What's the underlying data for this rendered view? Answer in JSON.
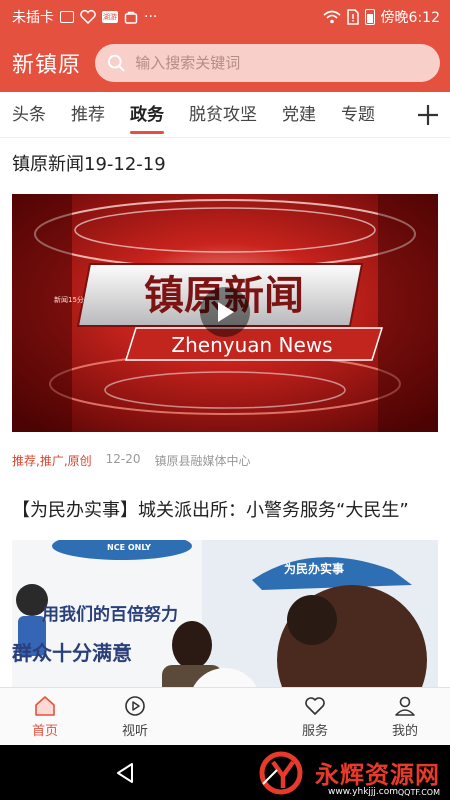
{
  "status_bar": {
    "carrier": "未插卡",
    "time": "傍晚6:12",
    "badge_text": "湖游"
  },
  "header": {
    "app_name": "新镇原",
    "search_placeholder": "输入搜索关键词"
  },
  "tabs": [
    {
      "label": "头条",
      "active": false
    },
    {
      "label": "推荐",
      "active": false
    },
    {
      "label": "政务",
      "active": true
    },
    {
      "label": "脱贫攻坚",
      "active": false
    },
    {
      "label": "党建",
      "active": false
    },
    {
      "label": "专题",
      "active": false
    }
  ],
  "feed": [
    {
      "title": "镇原新闻19-12-19",
      "thumbnail_title": "镇原新闻",
      "thumbnail_subtitle": "Zhenyuan News",
      "thumbnail_small": "新闻15分",
      "has_play_button": true,
      "tags": "推荐,推广,原创",
      "date": "12-20",
      "source": "镇原县融媒体中心"
    },
    {
      "title": "【为民办实事】城关派出所：小警务服务“大民生”",
      "thumbnail_banner": "为民办实事",
      "thumbnail_wall_line1": "用我们的百倍努力",
      "thumbnail_wall_line2": "群众十分满意",
      "thumbnail_logo": "NCE ONLY"
    }
  ],
  "bottom_nav": [
    {
      "label": "首页",
      "icon": "home-icon",
      "active": true
    },
    {
      "label": "视听",
      "icon": "play-circle-icon",
      "active": false
    },
    {
      "label": "",
      "icon": "video-camera-icon",
      "active": false
    },
    {
      "label": "服务",
      "icon": "heart-icon",
      "active": false
    },
    {
      "label": "我的",
      "icon": "user-icon",
      "active": false
    }
  ],
  "watermark": {
    "text": "永辉资源网",
    "url": "www.yhkjjj.com",
    "corner": "QQTF.COM"
  },
  "colors": {
    "brand_red": "#e4513f",
    "search_bg": "#f8d0c9",
    "tag_red": "#d8452f"
  }
}
